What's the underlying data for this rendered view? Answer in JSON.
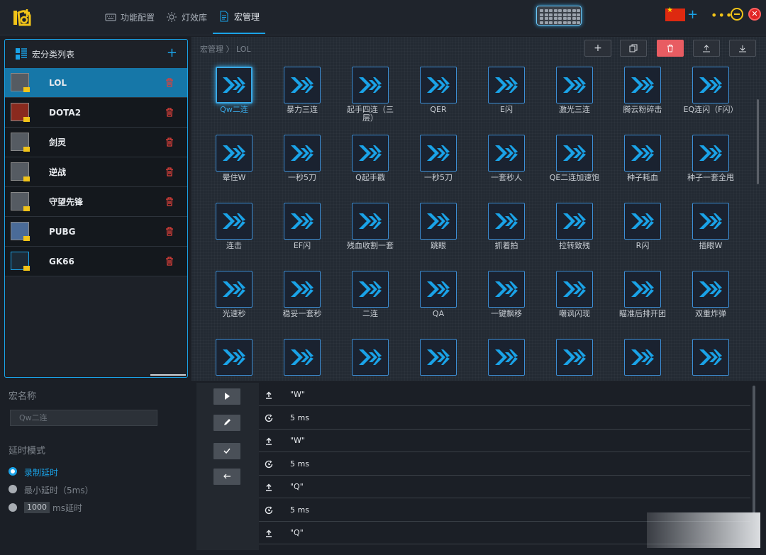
{
  "nav": {
    "items": [
      {
        "label": "功能配置",
        "icon": "keyboard-icon"
      },
      {
        "label": "灯效库",
        "icon": "light-icon"
      },
      {
        "label": "宏管理",
        "icon": "document-icon"
      }
    ],
    "active": 2
  },
  "sidebar": {
    "title": "宏分类列表",
    "add_label": "+",
    "categories": [
      {
        "label": "LOL"
      },
      {
        "label": "DOTA2"
      },
      {
        "label": "剑灵"
      },
      {
        "label": "逆战"
      },
      {
        "label": "守望先锋"
      },
      {
        "label": "PUBG"
      },
      {
        "label": "GK66"
      }
    ]
  },
  "main": {
    "breadcrumb": "宏管理 〉 LOL",
    "toolbar": {
      "add": "+"
    },
    "macros": [
      "Qw二连",
      "暴力三连",
      "起手四连（三层）",
      "QER",
      "E闪",
      "激光三连",
      "腾云粉碎击",
      "EQ连闪（F闪）",
      "晕住W",
      "一秒5刀",
      "Q起手戳",
      "一秒5刀",
      "一套秒人",
      "QE二连加速饱",
      "种子耗血",
      "种子一套全甩",
      "连击",
      "EF闪",
      "残血收割一套",
      "跳眼",
      "抓着拍",
      "拉转致残",
      "R闪",
      "插眼W",
      "光速秒",
      "稳妥一套秒",
      "二连",
      "QA",
      "一键飘移",
      "嘲讽闪现",
      "瞄准后排开团",
      "双重炸弹",
      "",
      "",
      "",
      "",
      "",
      "",
      "",
      ""
    ]
  },
  "props": {
    "name_label": "宏名称",
    "name_value": "Qw二连",
    "delay_label": "延时模式",
    "radio_record": "录制延时",
    "radio_min": "最小延时（5ms）",
    "radio_custom_value": "1000",
    "radio_custom_unit": "ms延时"
  },
  "steps": [
    {
      "type": "key",
      "icon": "key-press-icon",
      "text": "\"W\""
    },
    {
      "type": "delay",
      "icon": "clock-icon",
      "text": "5 ms"
    },
    {
      "type": "key",
      "icon": "key-release-icon",
      "text": "\"W\""
    },
    {
      "type": "delay",
      "icon": "clock-icon",
      "text": "5 ms"
    },
    {
      "type": "key",
      "icon": "key-press-icon",
      "text": "\"Q\""
    },
    {
      "type": "delay",
      "icon": "clock-icon",
      "text": "5 ms"
    },
    {
      "type": "key",
      "icon": "key-release-icon",
      "text": "\"Q\""
    }
  ],
  "colors": {
    "accent": "#1aa3e8",
    "delete": "#e85c62",
    "selected_row": "#1677a8"
  }
}
